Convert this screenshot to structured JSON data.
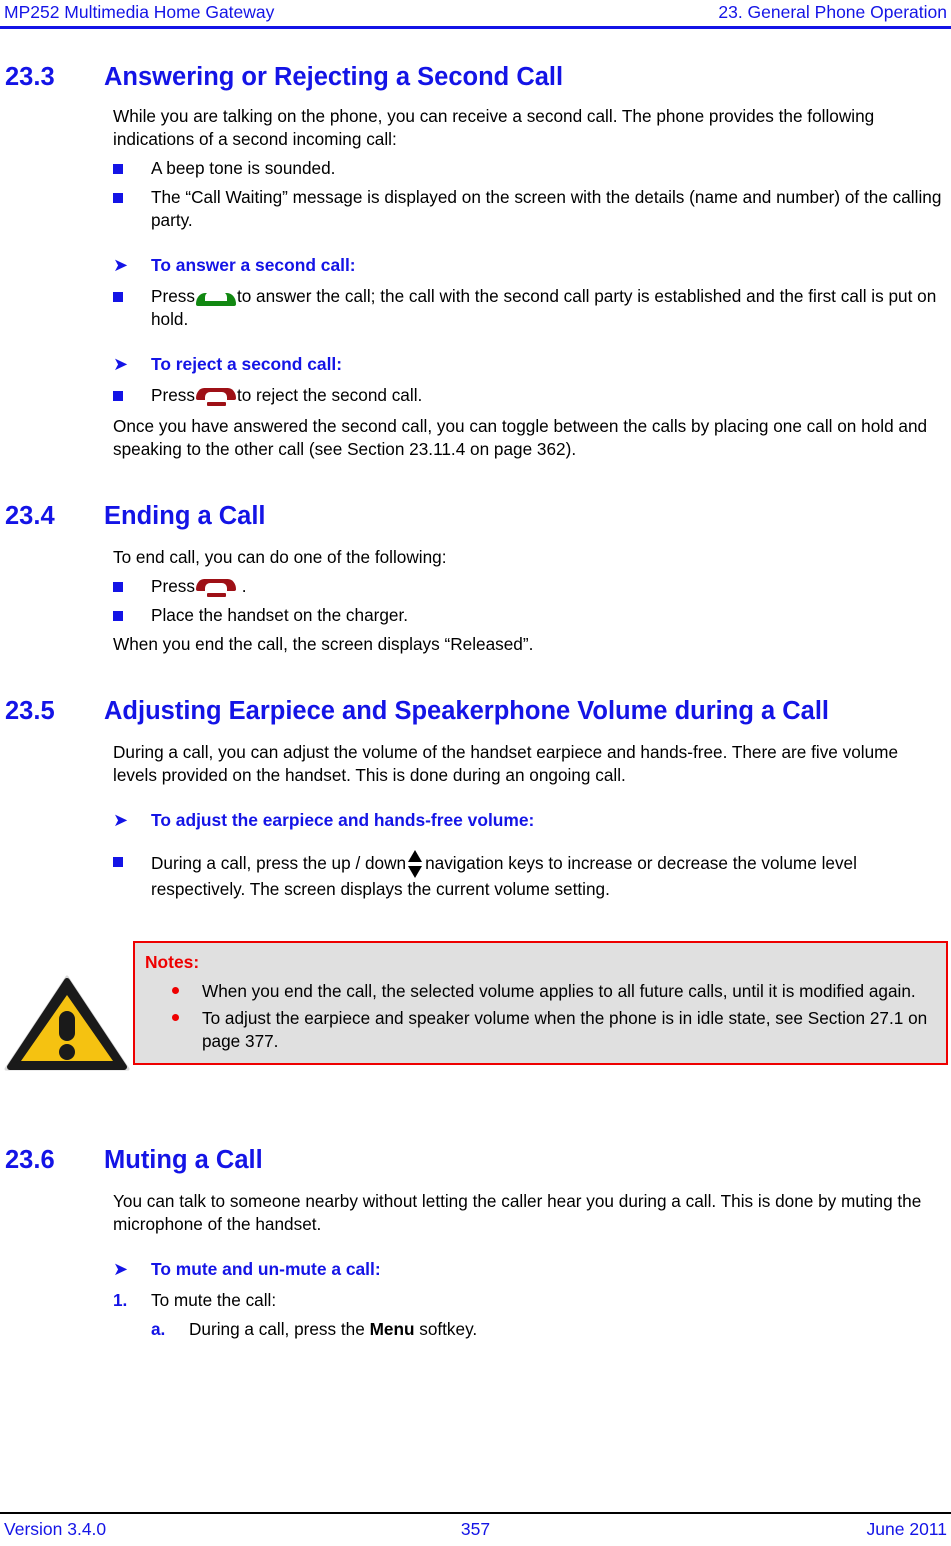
{
  "header": {
    "left": "MP252 Multimedia Home Gateway",
    "right": "23. General Phone Operation"
  },
  "footer": {
    "version": "Version 3.4.0",
    "page_number": "357",
    "date": "June 2011"
  },
  "colors": {
    "heading_blue": "#1414e6",
    "note_red": "#ee0000",
    "note_background": "#e0e0e0",
    "answer_key_green": "#118811",
    "end_key_red": "#9e1016",
    "warning_yellow": "#f5c211"
  },
  "sections": {
    "s233": {
      "number": "23.3",
      "title": "Answering or Rejecting a Second Call",
      "intro": "While you are talking on the phone, you can receive a second call. The phone provides the following indications of a second incoming call:",
      "indications": [
        "A beep tone is sounded.",
        "The “Call Waiting” message is displayed on the screen with the details (name and number) of the calling party."
      ],
      "answer_heading": "To answer a second call:",
      "answer_step_pre": "Press",
      "answer_step_post": "to answer the call; the call with the second call party is established and the first call is put on hold.",
      "reject_heading": "To reject a second call:",
      "reject_step_pre": "Press",
      "reject_step_post": "to reject the second call.",
      "outro": "Once you have answered the second call, you can toggle between the calls by placing one call on hold and speaking to the other call (see Section 23.11.4 on page 362)."
    },
    "s234": {
      "number": "23.4",
      "title": "Ending a Call",
      "intro": "To end call, you can do one of the following:",
      "step_press_pre": "Press",
      "step_press_post": ".",
      "step_charger": "Place the handset on the charger.",
      "outro": "When you end the call, the screen displays “Released”."
    },
    "s235": {
      "number": "23.5",
      "title": "Adjusting Earpiece and Speakerphone Volume during a Call",
      "intro": "During a call, you can adjust the volume of the handset earpiece and hands-free. There are five volume levels provided on the handset. This is done during an ongoing call.",
      "adjust_heading": "To adjust the earpiece and hands-free volume:",
      "adjust_step_pre": "During a call, press the up / down",
      "adjust_step_post": "navigation keys to increase or decrease the volume level respectively. The screen displays the current volume setting.",
      "notes": {
        "title": "Notes:",
        "items": [
          "When you end the call, the selected volume applies to all future calls, until it is modified again.",
          "To adjust the earpiece and speaker volume when the phone is in idle state, see Section 27.1 on page 377."
        ]
      }
    },
    "s236": {
      "number": "23.6",
      "title": "Muting a Call",
      "intro": "You can talk to someone nearby without letting the caller hear you during a call. This is done by muting the microphone of the handset.",
      "mute_heading": "To mute and un-mute a call:",
      "step1_marker": "1.",
      "step1_text": "To mute the call:",
      "step1a_marker": "a.",
      "step1a_pre": "During a call, press the",
      "step1a_bold": "Menu",
      "step1a_post": "softkey."
    }
  },
  "icons": {
    "arrow_bullet": "➤",
    "answer_key": "green-handset-answer-icon",
    "end_key": "red-handset-end-icon",
    "updown_key": "up-down-navigation-icon",
    "warning": "warning-triangle-icon"
  }
}
